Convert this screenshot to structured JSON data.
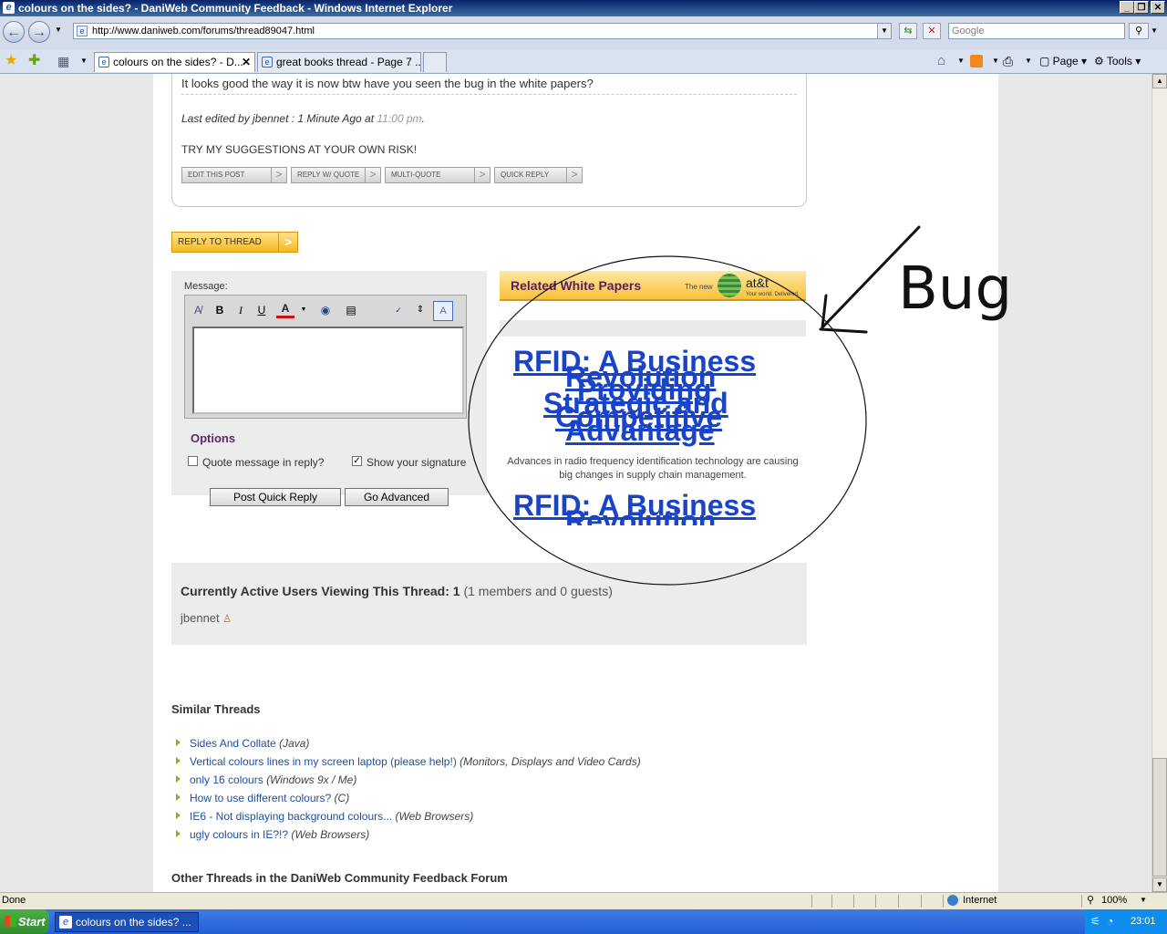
{
  "window": {
    "title": "colours on the sides? - DaniWeb Community Feedback - Windows Internet Explorer"
  },
  "address": {
    "url": "http://www.daniweb.com/forums/thread89047.html",
    "search_placeholder": "Google"
  },
  "tabs": [
    {
      "label": "colours on the sides? - D...",
      "active": true
    },
    {
      "label": "great books thread - Page 7 ...",
      "active": false
    }
  ],
  "toolbar": {
    "page_label": "Page",
    "tools_label": "Tools"
  },
  "post": {
    "text": "It looks good the way it is now btw have you seen the bug in the white papers?",
    "edited_prefix": "Last edited by jbennet : 1 Minute Ago at ",
    "edited_time": "11:00 pm",
    "edited_suffix": ".",
    "signature": "TRY MY SUGGESTIONS AT YOUR OWN RISK!",
    "buttons": [
      "EDIT THIS POST",
      "REPLY W/ QUOTE",
      "MULTI-QUOTE",
      "QUICK REPLY"
    ]
  },
  "reply_thread_label": "REPLY TO THREAD",
  "quick_reply": {
    "message_label": "Message:",
    "options_label": "Options",
    "quote_label": "Quote message in reply?",
    "quote_checked": false,
    "signature_label": "Show your signature",
    "signature_checked": true,
    "post_button": "Post Quick Reply",
    "advanced_button": "Go Advanced"
  },
  "white_papers": {
    "header": "Related White Papers",
    "brand_tag": "The new",
    "brand": "at&t",
    "brand_sub": "Your world. Delivered.",
    "link1": "RFID: A Business",
    "link1b": "Revolution",
    "link2": "Providing",
    "link2b": "Strategic and",
    "link2c": "Competitive",
    "link2d": "Advantage",
    "description": "Advances in radio frequency identification technology are causing big changes in supply chain management.",
    "link3": "RFID: A Business",
    "link3b": "Revolution"
  },
  "annotation": {
    "text": "Bug"
  },
  "active_users": {
    "label": "Currently Active Users Viewing This Thread:",
    "count": "1",
    "detail": "(1 members and 0 guests)",
    "user": "jbennet"
  },
  "similar_threads": {
    "heading": "Similar Threads",
    "items": [
      {
        "title": "Sides And Collate",
        "forum": "(Java)"
      },
      {
        "title": "Vertical colours lines in my screen laptop (please help!)",
        "forum": "(Monitors, Displays and Video Cards)"
      },
      {
        "title": "only 16 colours",
        "forum": "(Windows 9x / Me)"
      },
      {
        "title": "How to use different colours?",
        "forum": "(C)"
      },
      {
        "title": "IE6 - Not displaying background colours...",
        "forum": "(Web Browsers)"
      },
      {
        "title": "ugly colours in IE?!?",
        "forum": "(Web Browsers)"
      }
    ]
  },
  "other_threads_heading": "Other Threads in the DaniWeb Community Feedback Forum",
  "status": {
    "text": "Done",
    "zone": "Internet",
    "zoom": "100%"
  },
  "taskbar": {
    "start": "Start",
    "item": "colours on the sides? ...",
    "clock": "23:01"
  },
  "colors": {
    "link": "#1A44C8",
    "header_gold": "#F7C23C"
  }
}
